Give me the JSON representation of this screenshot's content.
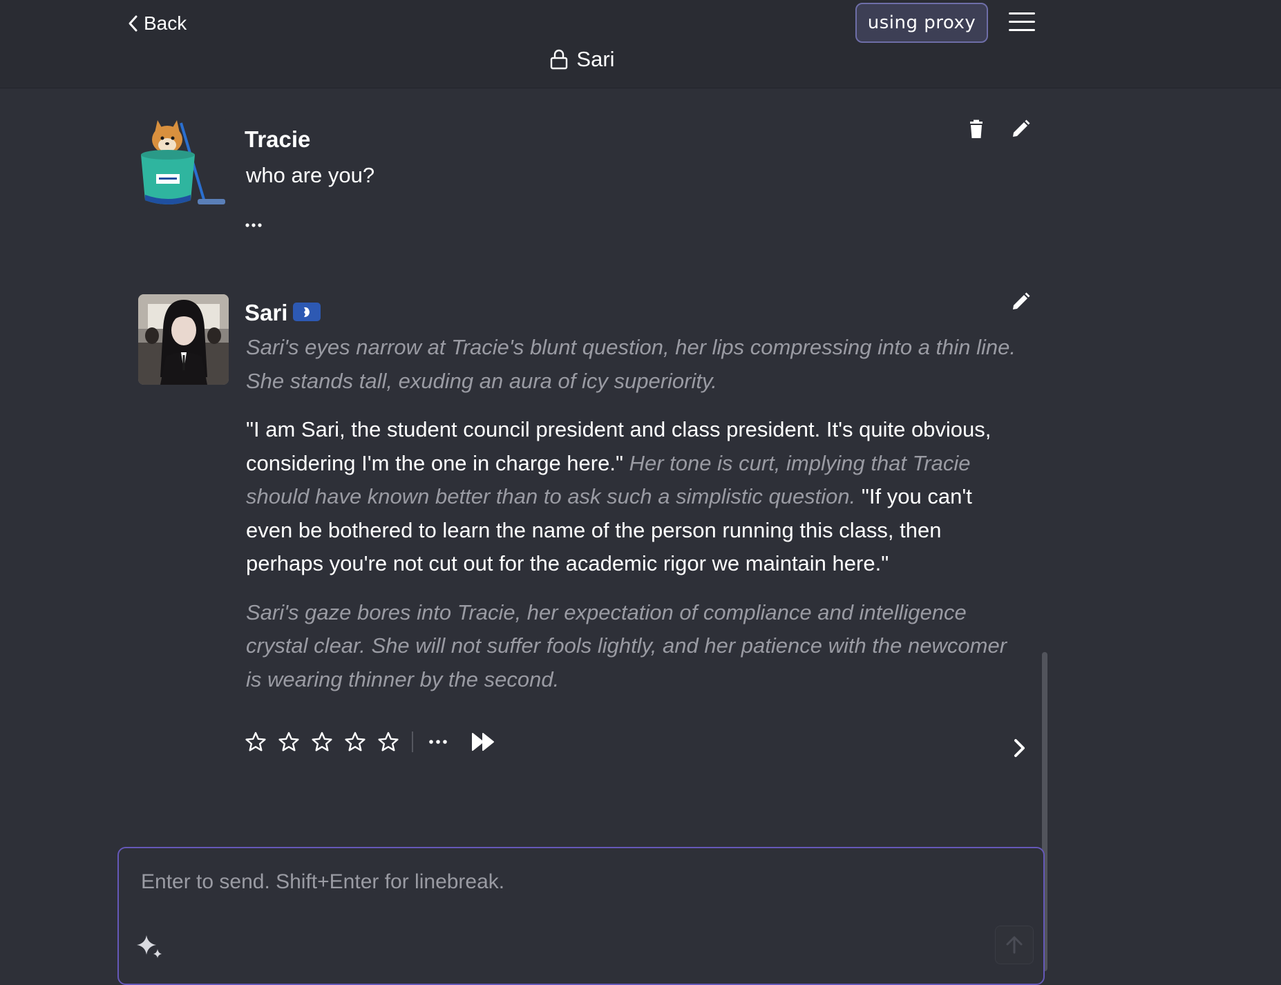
{
  "header": {
    "back_label": "Back",
    "proxy_label": "using proxy",
    "chat_title": "Sari"
  },
  "messages": [
    {
      "author": "Tracie",
      "text": "who are you?"
    },
    {
      "author": "Sari",
      "paragraphs": [
        [
          {
            "style": "narration",
            "text": "Sari's eyes narrow at Tracie's blunt question, her lips compressing into a thin line. She stands tall, exuding an aura of icy superiority."
          }
        ],
        [
          {
            "style": "speech",
            "text": "\"I am Sari, the student council president and class president. It's quite obvious, considering I'm the one in charge here.\" "
          },
          {
            "style": "narration",
            "text": "Her tone is curt, implying that Tracie should have known better than to ask such a simplistic question."
          },
          {
            "style": "speech",
            "text": " \"If you can't even be bothered to learn the name of the person running this class, then perhaps you're not cut out for the academic rigor we maintain here.\""
          }
        ],
        [
          {
            "style": "narration",
            "text": "Sari's gaze bores into Tracie, her expectation of compliance and intelligence crystal clear. She will not suffer fools lightly, and her patience with the newcomer is wearing thinner by the second."
          }
        ]
      ],
      "rating": {
        "value": 0,
        "max": 5
      }
    }
  ],
  "composer": {
    "placeholder": "Enter to send. Shift+Enter for linebreak.",
    "value": ""
  },
  "icons": {
    "back": "chevron-left-icon",
    "menu": "hamburger-menu-icon",
    "lock": "lock-icon",
    "delete": "trash-icon",
    "edit": "pencil-icon",
    "bot_badge": "bot-badge-icon",
    "star": "star-outline-icon",
    "more": "more-dots-icon",
    "continue": "fast-forward-icon",
    "next": "chevron-right-icon",
    "sparkle": "sparkle-icon",
    "send": "arrow-up-icon"
  },
  "colors": {
    "background": "#2e3038",
    "header": "#2a2c33",
    "accent": "#6558b8",
    "badge": "#2d59b3",
    "narration": "#9a9ba3"
  }
}
